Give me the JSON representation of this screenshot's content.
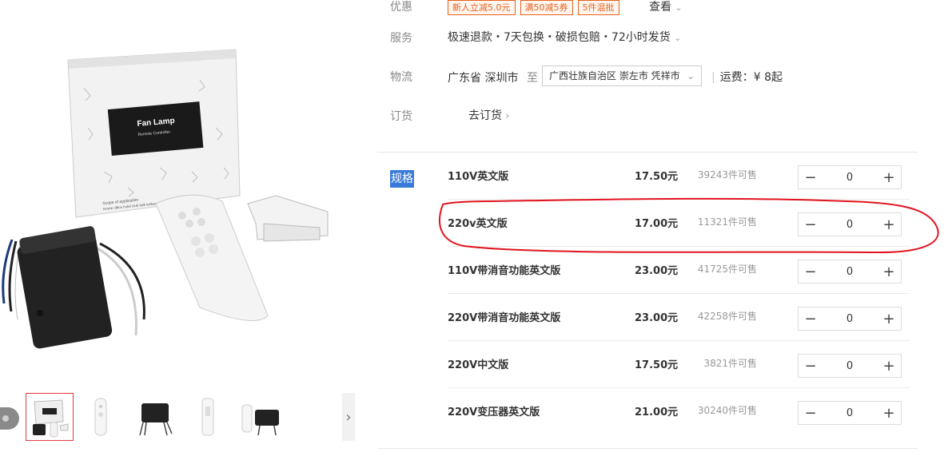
{
  "labels": {
    "promo": "优惠",
    "service": "服务",
    "logistics": "物流",
    "order": "订货",
    "spec": "规格"
  },
  "promo_tags": [
    "新人立减5.0元",
    "满50减5券",
    "5件混批"
  ],
  "promo_more": "查看",
  "service_text": "极速退款・7天包换・破损包赔・72小时发货",
  "logistics": {
    "from": "广东省 深圳市",
    "to_label": "至",
    "destination": "广西壮族自治区 崇左市 凭祥市",
    "fee": "运费：¥ 8起"
  },
  "order_link": "去订货",
  "product_box_text": {
    "title": "Fan Lamp",
    "subtitle": "Remote Controller",
    "scope": "Scope of application",
    "scope_desc": "Home office hotel club hall restaurant"
  },
  "skus": [
    {
      "name": "110V英文版",
      "price": "17.50元",
      "stock": "39243件可售",
      "qty": "0"
    },
    {
      "name": "220v英文版",
      "price": "17.00元",
      "stock": "11321件可售",
      "qty": "0"
    },
    {
      "name": "110V带消音功能英文版",
      "price": "23.00元",
      "stock": "41725件可售",
      "qty": "0"
    },
    {
      "name": "220V带消音功能英文版",
      "price": "23.00元",
      "stock": "42258件可售",
      "qty": "0"
    },
    {
      "name": "220V中文版",
      "price": "17.50元",
      "stock": "3821件可售",
      "qty": "0"
    },
    {
      "name": "220V变压器英文版",
      "price": "21.00元",
      "stock": "30240件可售",
      "qty": "0"
    }
  ],
  "stepper": {
    "minus": "−",
    "plus": "+"
  },
  "icons": {
    "chevron": "chevron-down-icon",
    "next": "chevron-right-icon"
  },
  "colors": {
    "tag": "#e5621e",
    "spec_highlight": "#3879d9",
    "annotation": "#e0141e"
  }
}
